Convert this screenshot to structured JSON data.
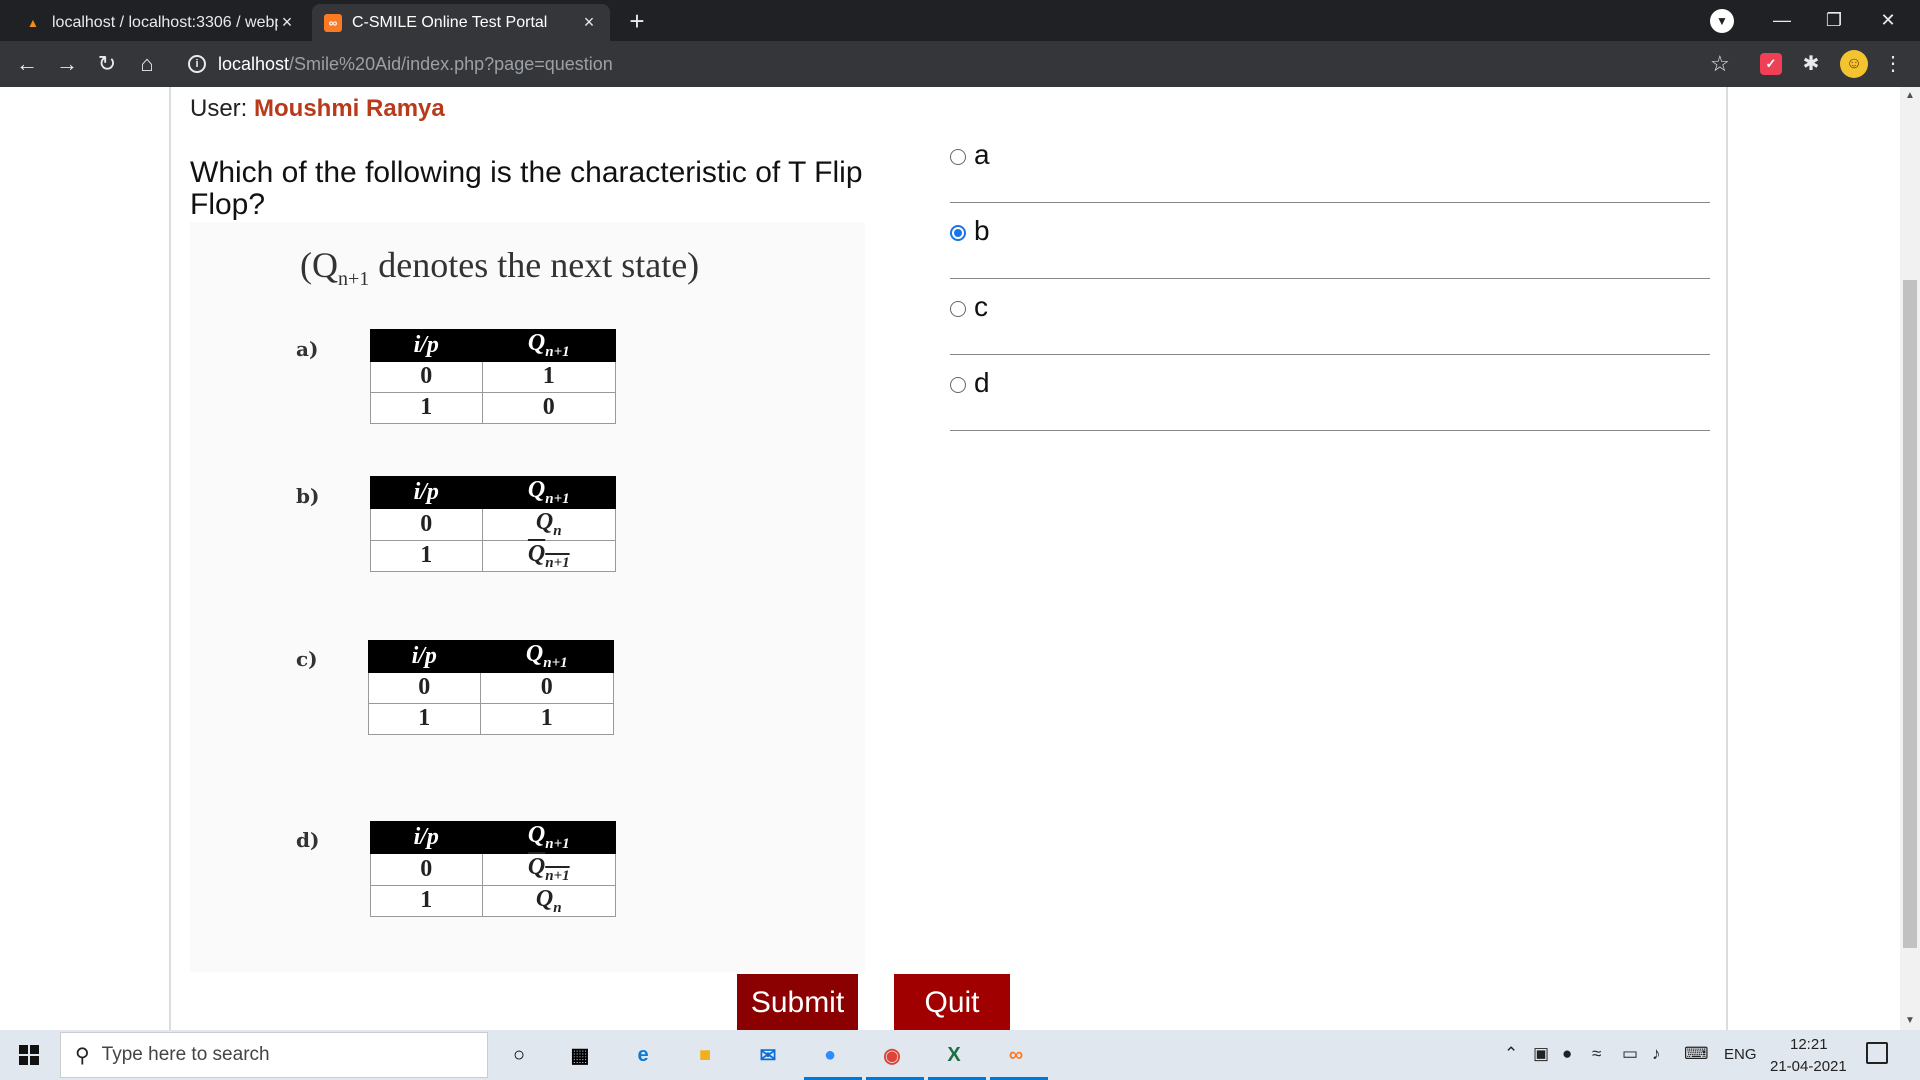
{
  "browser": {
    "tabs": [
      {
        "title": "localhost / localhost:3306 / webp",
        "active": false,
        "favicon": "phpmyadmin-icon"
      },
      {
        "title": "C-SMILE Online Test Portal",
        "active": true,
        "favicon": "xampp-icon"
      }
    ],
    "url_host": "localhost",
    "url_path": "/Smile%20Aid/index.php?page=question"
  },
  "page": {
    "user_label": "User:",
    "user_name": "Moushmi Ramya",
    "question": "Which of the following is the characteristic of T Flip Flop?",
    "image_note": "denotes the next state)",
    "image_note_prefix": "(Q",
    "image_note_sub": "n+1",
    "image_options": [
      {
        "label": "a)",
        "header": [
          "i/p",
          "Q",
          "n+1"
        ],
        "rows": [
          [
            "0",
            "1"
          ],
          [
            "1",
            "0"
          ]
        ]
      },
      {
        "label": "b)",
        "header": [
          "i/p",
          "Q",
          "n+1"
        ],
        "rows": [
          [
            "0",
            "Qn"
          ],
          [
            "1",
            "Qn+1 (overline)"
          ]
        ]
      },
      {
        "label": "c)",
        "header": [
          "i/p",
          "Q",
          "n+1"
        ],
        "rows": [
          [
            "0",
            "0"
          ],
          [
            "1",
            "1"
          ]
        ]
      },
      {
        "label": "d)",
        "header": [
          "i/p",
          "Q",
          "n+1"
        ],
        "rows": [
          [
            "0",
            "Qn+1 (overline)"
          ],
          [
            "1",
            "Qn"
          ]
        ]
      }
    ],
    "answers": [
      {
        "text": "a",
        "selected": false
      },
      {
        "text": "b",
        "selected": true
      },
      {
        "text": "c",
        "selected": false
      },
      {
        "text": "d",
        "selected": false
      }
    ],
    "submit_label": "Submit",
    "quit_label": "Quit"
  },
  "taskbar": {
    "search_placeholder": "Type here to search",
    "language": "ENG",
    "time": "12:21",
    "date": "21-04-2021"
  },
  "colors": {
    "user_name": "#b83a1a",
    "submit_button": "#8b0000",
    "quit_button": "#a00000",
    "radio_checked": "#1a73e8"
  }
}
